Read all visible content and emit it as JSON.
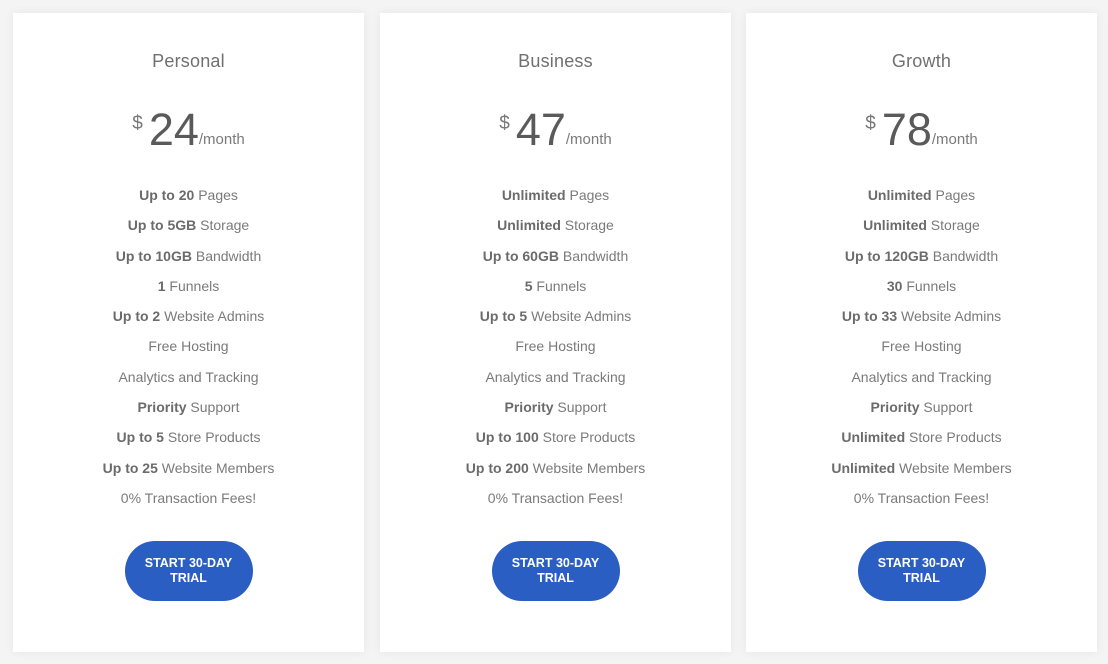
{
  "plans": [
    {
      "name": "Personal",
      "currency": "$",
      "amount": "24",
      "period": "/month",
      "features": [
        {
          "bold": "Up to 20",
          "text": " Pages"
        },
        {
          "bold": "Up to 5GB",
          "text": " Storage"
        },
        {
          "bold": "Up to 10GB",
          "text": " Bandwidth"
        },
        {
          "bold": "1",
          "text": " Funnels"
        },
        {
          "bold": "Up to 2",
          "text": " Website Admins"
        },
        {
          "bold": "",
          "text": "Free Hosting"
        },
        {
          "bold": "",
          "text": "Analytics and Tracking"
        },
        {
          "bold": "Priority",
          "text": " Support"
        },
        {
          "bold": "Up to 5",
          "text": " Store Products"
        },
        {
          "bold": "Up to 25",
          "text": " Website Members"
        },
        {
          "bold": "",
          "text": "0% Transaction Fees!"
        }
      ],
      "cta_label": "START 30-DAY TRIAL"
    },
    {
      "name": "Business",
      "currency": "$",
      "amount": "47",
      "period": "/month",
      "features": [
        {
          "bold": "Unlimited",
          "text": " Pages"
        },
        {
          "bold": "Unlimited",
          "text": " Storage"
        },
        {
          "bold": "Up to 60GB",
          "text": " Bandwidth"
        },
        {
          "bold": "5",
          "text": " Funnels"
        },
        {
          "bold": "Up to 5",
          "text": " Website Admins"
        },
        {
          "bold": "",
          "text": "Free Hosting"
        },
        {
          "bold": "",
          "text": "Analytics and Tracking"
        },
        {
          "bold": "Priority",
          "text": " Support"
        },
        {
          "bold": "Up to 100",
          "text": " Store Products"
        },
        {
          "bold": "Up to 200",
          "text": " Website Members"
        },
        {
          "bold": "",
          "text": "0% Transaction Fees!"
        }
      ],
      "cta_label": "START 30-DAY TRIAL"
    },
    {
      "name": "Growth",
      "currency": "$",
      "amount": "78",
      "period": "/month",
      "features": [
        {
          "bold": "Unlimited",
          "text": " Pages"
        },
        {
          "bold": "Unlimited",
          "text": " Storage"
        },
        {
          "bold": "Up to 120GB",
          "text": " Bandwidth"
        },
        {
          "bold": "30",
          "text": " Funnels"
        },
        {
          "bold": "Up to 33",
          "text": " Website Admins"
        },
        {
          "bold": "",
          "text": "Free Hosting"
        },
        {
          "bold": "",
          "text": "Analytics and Tracking"
        },
        {
          "bold": "Priority",
          "text": " Support"
        },
        {
          "bold": "Unlimited",
          "text": " Store Products"
        },
        {
          "bold": "Unlimited",
          "text": " Website Members"
        },
        {
          "bold": "",
          "text": "0% Transaction Fees!"
        }
      ],
      "cta_label": "START 30-DAY TRIAL"
    }
  ],
  "colors": {
    "cta_background": "#2b5ec2",
    "cta_text": "#ffffff",
    "page_background": "#f4f4f4",
    "card_background": "#ffffff"
  }
}
